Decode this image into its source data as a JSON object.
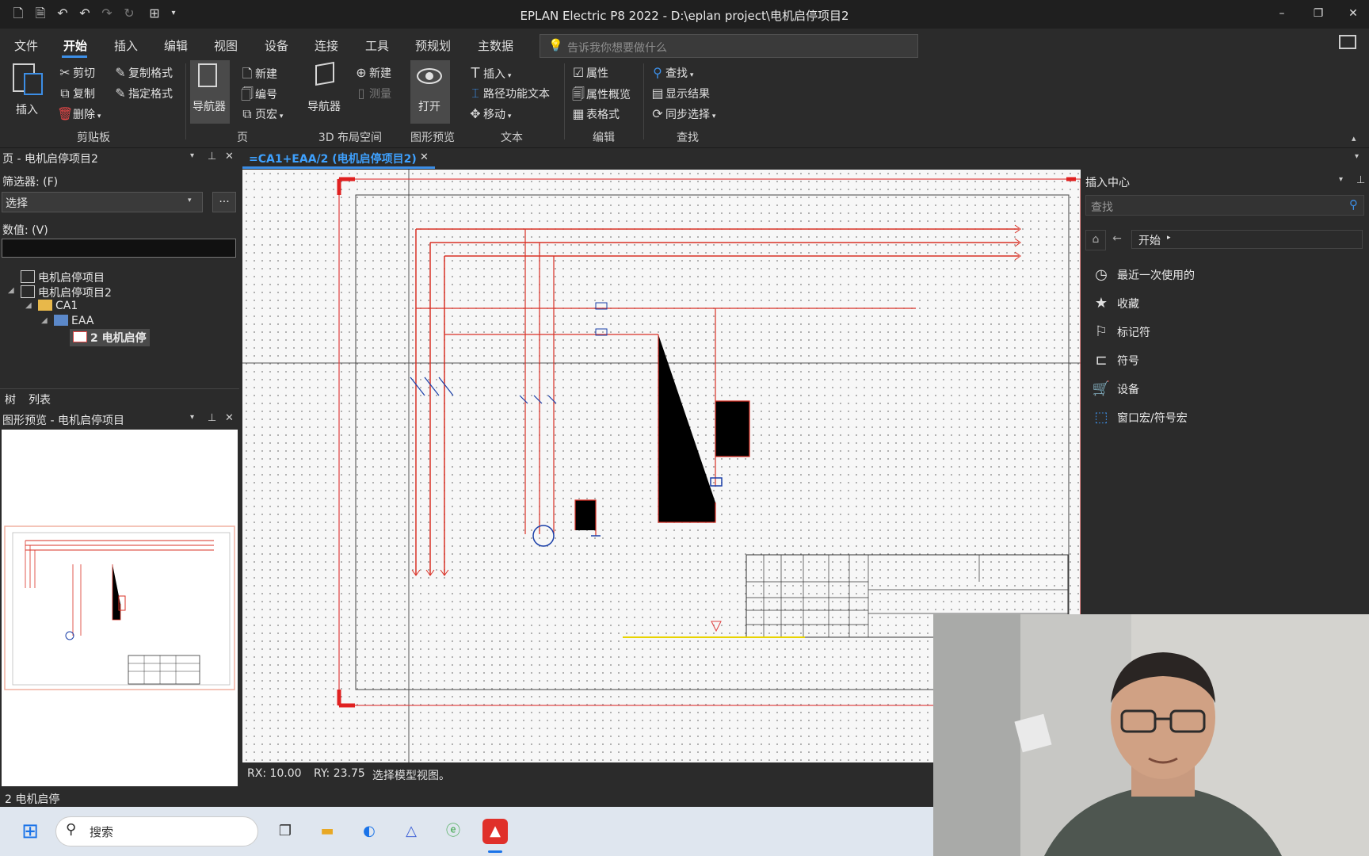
{
  "window": {
    "title": "EPLAN Electric P8 2022 - D:\\eplan project\\电机启停项目2"
  },
  "menu": [
    "文件",
    "开始",
    "插入",
    "编辑",
    "视图",
    "设备",
    "连接",
    "工具",
    "预规划",
    "主数据"
  ],
  "menu_active": "开始",
  "tellme": {
    "placeholder": "告诉我你想要做什么"
  },
  "ribbon": {
    "insert_label": "插入",
    "cut": "剪切",
    "copy_format": "复制格式",
    "copy": "复制",
    "assign_format": "指定格式",
    "delete": "删除",
    "navigator": "导航器",
    "new": "新建",
    "number": "编号",
    "page_macro": "页宏",
    "navigator2": "导航器",
    "new2": "新建",
    "measure": "测量",
    "open": "打开",
    "text_insert": "插入",
    "path_text": "路径功能文本",
    "move": "移动",
    "property": "属性",
    "property_overview": "属性概览",
    "table_format": "表格式",
    "find": "查找",
    "show_results": "显示结果",
    "sync_select": "同步选择",
    "groups": {
      "clipboard": "剪贴板",
      "page": "页",
      "layout3d": "3D 布局空间",
      "graphic_preview": "图形预览",
      "text": "文本",
      "edit": "编辑",
      "search": "查找"
    }
  },
  "page_panel": {
    "title": "页 - 电机启停项目2",
    "filter_label": "筛选器: (F)",
    "filter_value": "选择",
    "more": "...",
    "value_label": "数值: (V)",
    "tree": [
      "电机启停项目",
      "电机启停项目2",
      "CA1",
      "EAA",
      "2 电机启停"
    ],
    "tabs": [
      "树",
      "列表"
    ]
  },
  "preview_panel": {
    "title": "图形预览 - 电机启停项目"
  },
  "doc_tab": {
    "label": "=CA1+EAA/2 (电机启停项目2)"
  },
  "canvas_status": {
    "rx": "RX: 10.00",
    "ry": "RY: 23.75",
    "msg": "选择模型视图。"
  },
  "insert_center": {
    "title": "插入中心",
    "search_placeholder": "查找",
    "breadcrumb": "开始",
    "items": [
      {
        "icon": "clock-icon",
        "label": "最近一次使用的"
      },
      {
        "icon": "star-icon",
        "label": "收藏"
      },
      {
        "icon": "marker-icon",
        "label": "标记符"
      },
      {
        "icon": "symbol-icon",
        "label": "符号"
      },
      {
        "icon": "cart-icon",
        "label": "设备"
      },
      {
        "icon": "macro-icon",
        "label": "窗口宏/符号宏"
      }
    ]
  },
  "bottom_status": {
    "page": "2 电机启停"
  },
  "taskbar": {
    "search_label": "搜索"
  },
  "colors": {
    "accent": "#3c8ee6",
    "tab_text": "#3ea1ff",
    "wire": "#d93025",
    "symbol": "#1a3fa8"
  }
}
